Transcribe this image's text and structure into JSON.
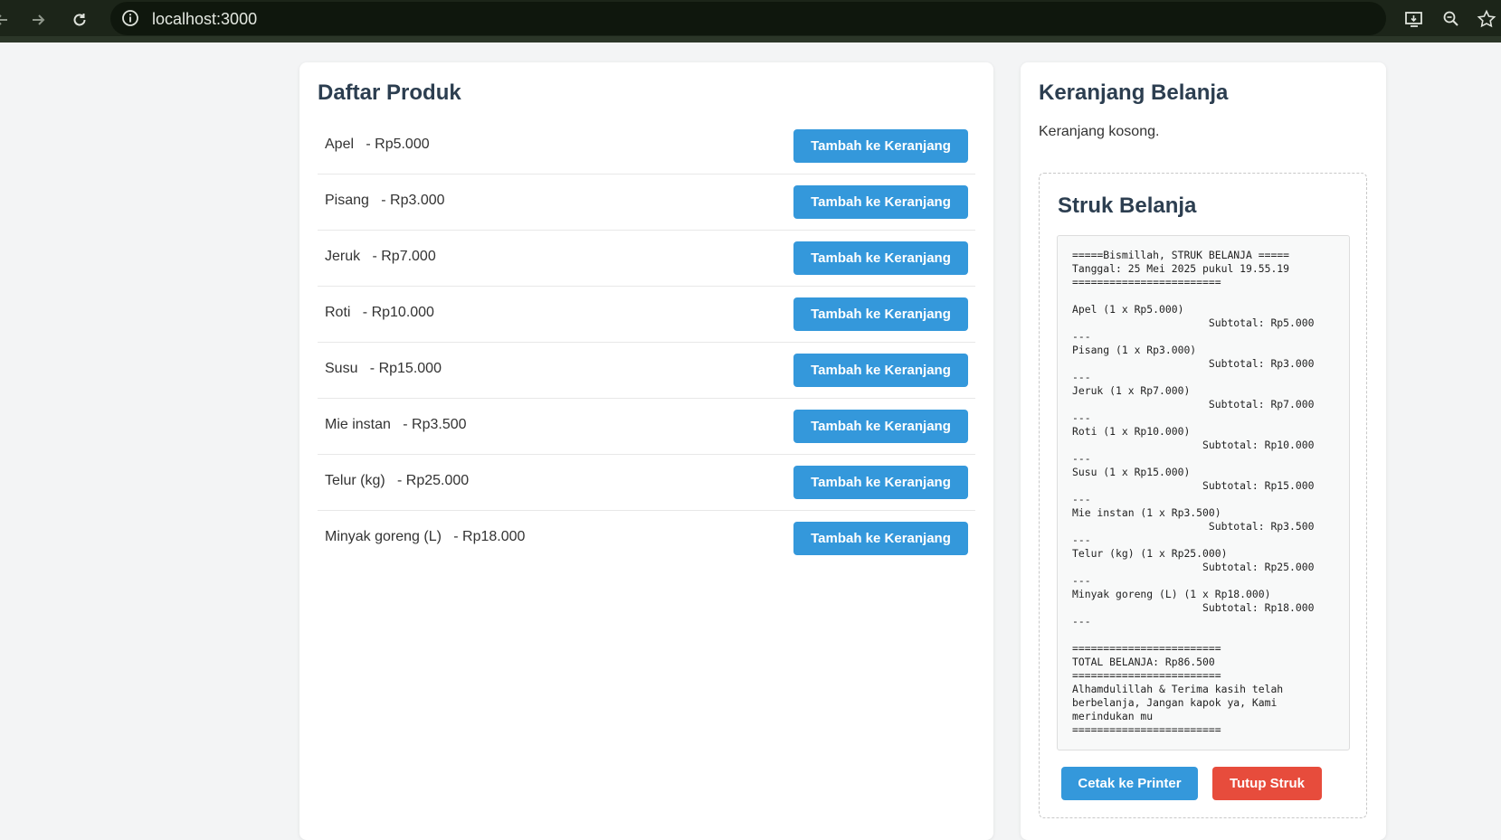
{
  "browser": {
    "url": "localhost:3000"
  },
  "products": {
    "title": "Daftar Produk",
    "add_label": "Tambah ke Keranjang",
    "items": [
      {
        "text": "Apel   - Rp5.000"
      },
      {
        "text": "Pisang   - Rp3.000"
      },
      {
        "text": "Jeruk   - Rp7.000"
      },
      {
        "text": "Roti   - Rp10.000"
      },
      {
        "text": "Susu   - Rp15.000"
      },
      {
        "text": "Mie instan   - Rp3.500"
      },
      {
        "text": "Telur (kg)   - Rp25.000"
      },
      {
        "text": "Minyak goreng (L)   - Rp18.000"
      }
    ]
  },
  "cart": {
    "title": "Keranjang Belanja",
    "empty_text": "Keranjang kosong."
  },
  "receipt": {
    "title": "Struk Belanja",
    "content": "=====Bismillah, STRUK BELANJA =====\nTanggal: 25 Mei 2025 pukul 19.55.19\n========================\n\nApel (1 x Rp5.000)\n                      Subtotal: Rp5.000\n---\nPisang (1 x Rp3.000)\n                      Subtotal: Rp3.000\n---\nJeruk (1 x Rp7.000)\n                      Subtotal: Rp7.000\n---\nRoti (1 x Rp10.000)\n                     Subtotal: Rp10.000\n---\nSusu (1 x Rp15.000)\n                     Subtotal: Rp15.000\n---\nMie instan (1 x Rp3.500)\n                      Subtotal: Rp3.500\n---\nTelur (kg) (1 x Rp25.000)\n                     Subtotal: Rp25.000\n---\nMinyak goreng (L) (1 x Rp18.000)\n                     Subtotal: Rp18.000\n---\n\n========================\nTOTAL BELANJA: Rp86.500\n========================\nAlhamdulillah & Terima kasih telah\nberbelanja, Jangan kapok ya, Kami\nmerindukan mu\n========================",
    "print_label": "Cetak ke Printer",
    "close_label": "Tutup Struk"
  },
  "colors": {
    "primary": "#3498db",
    "danger": "#e74c3c",
    "heading": "#2c3e50"
  },
  "icons": [
    "back-arrow-icon",
    "forward-arrow-icon",
    "reload-icon",
    "info-icon",
    "install-app-icon",
    "zoom-icon",
    "bookmark-star-icon"
  ]
}
